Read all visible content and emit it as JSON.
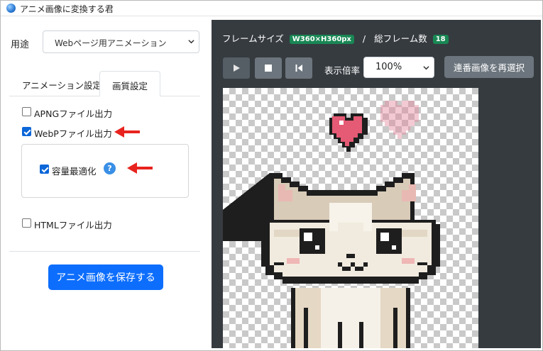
{
  "window": {
    "title": "アニメ画像に変換する君"
  },
  "left_panel": {
    "usage_label": "用途",
    "usage_value": "Webページ用アニメーション",
    "tabs": [
      {
        "label": "アニメーション設定",
        "active": false
      },
      {
        "label": "画質設定",
        "active": true
      }
    ],
    "options": {
      "apng": {
        "label": "APNGファイル出力",
        "checked": false
      },
      "webp": {
        "label": "WebPファイル出力",
        "checked": true
      },
      "optimize": {
        "label": "容量最適化",
        "checked": true
      },
      "html": {
        "label": "HTMLファイル出力",
        "checked": false
      }
    },
    "help_icon_text": "?",
    "save_button": "アニメ画像を保存する"
  },
  "preview": {
    "frame_size_label": "フレームサイズ",
    "frame_size_value": "W360×H360px",
    "separator": "/",
    "total_frames_label": "総フレーム数",
    "total_frames_value": "18",
    "zoom_label": "表示倍率",
    "zoom_value": "100%",
    "reselect_button": "連番画像を再選択",
    "image_description_icon": "pixel-cat-with-hearts"
  },
  "colors": {
    "accent_blue": "#0d6efd",
    "badge_green": "#198754",
    "preview_bg": "#363b40",
    "arrow_red": "#e8231e",
    "button_gray": "#6c757d"
  }
}
